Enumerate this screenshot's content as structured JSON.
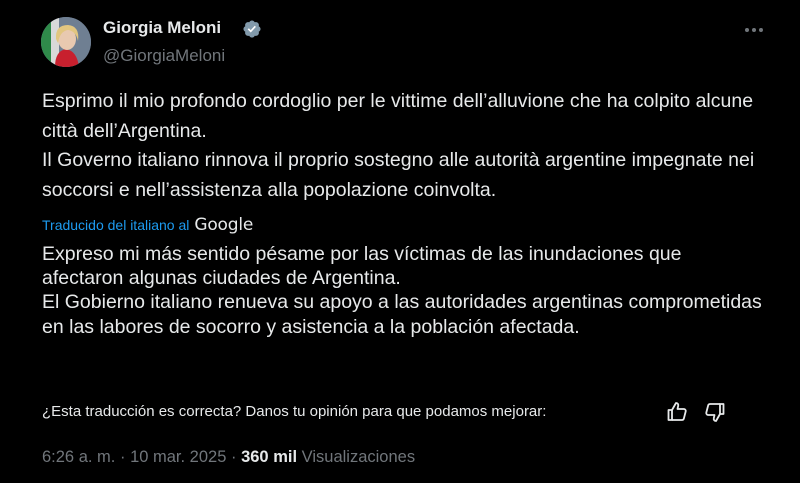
{
  "author": {
    "display_name": "Giorgia Meloni",
    "handle": "@GiorgiaMeloni",
    "verified_icon": "verified-badge-icon",
    "verified_color": "#829aab"
  },
  "tweet": {
    "original_paragraphs": [
      "Esprimo il mio profondo cordoglio per le vittime dell’alluvione che ha colpito alcune città dell’Argentina.",
      "Il Governo italiano rinnova il proprio sostegno alle autorità argentine impegnate nei soccorsi e nell’assistenza alla popolazione coinvolta."
    ],
    "translation_label": "Traducido del italiano al",
    "translation_provider": "Google",
    "translated_paragraphs": [
      "Expreso mi más sentido pésame por las víctimas de las inundaciones que afectaron algunas ciudades de Argentina.",
      "El Gobierno italiano renueva su apoyo a las autoridades argentinas comprometidas en las labores de socorro y asistencia a la población afectada."
    ],
    "feedback_prompt": "¿Esta traducción es correcta? Danos tu opinión para que podamos mejorar:"
  },
  "meta": {
    "time": "6:26 a. m.",
    "separator": "·",
    "date": "10 mar. 2025",
    "views_count": "360 mil",
    "views_label": "Visualizaciones"
  },
  "colors": {
    "background": "#000000",
    "text": "#e7e9ea",
    "secondary": "#71767b",
    "link": "#1d9bf0"
  }
}
